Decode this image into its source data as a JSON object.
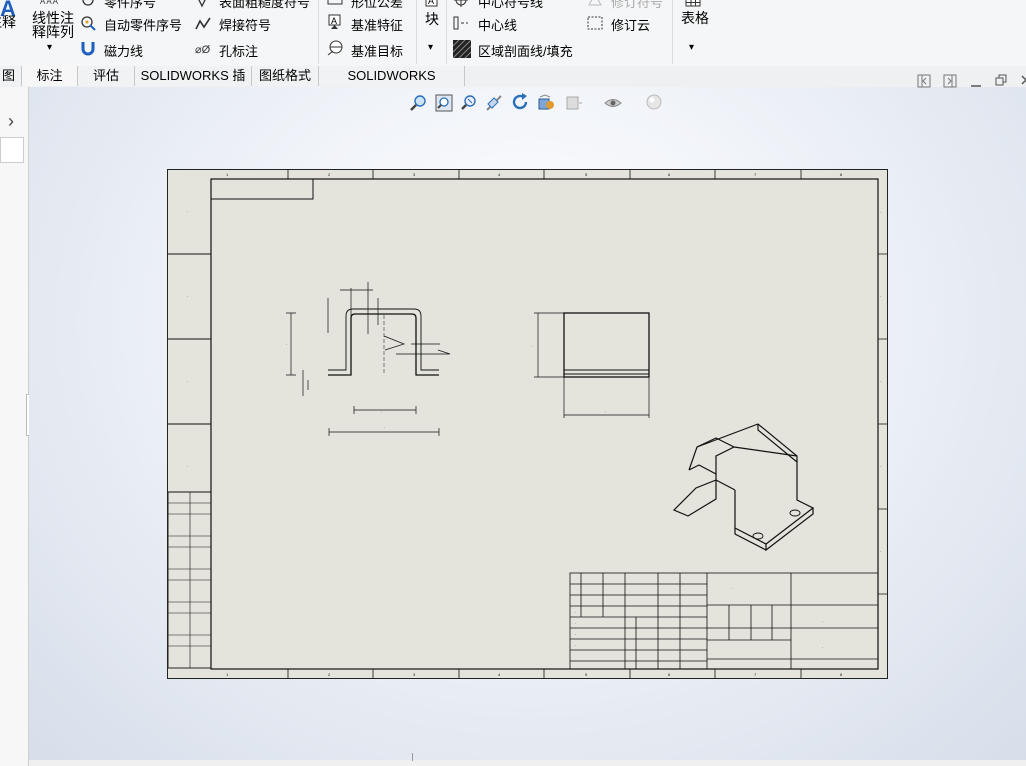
{
  "ribbon": {
    "annotation_big": "注释",
    "linear_pattern": [
      "线性注",
      "释阵列"
    ],
    "part_number": "零件序号",
    "auto_part_number": "自动零件序号",
    "magnetic_line": "磁力线",
    "surface_finish": "表面粗糙度符号",
    "weld_symbol": "焊接符号",
    "hole_callout": "孔标注",
    "geometric_tolerance": "形位公差",
    "datum_feature": "基准特征",
    "datum_target": "基准目标",
    "block": "块",
    "center_mark": "中心符号线",
    "centerline": "中心线",
    "area_hatch": "区域剖面线/填充",
    "revision_symbol": "修订符号",
    "revision_cloud": "修订云",
    "tables": "表格",
    "dropdown_arrow": "▾"
  },
  "tabs": [
    "图",
    "标注",
    "评估",
    "SOLIDWORKS 插件",
    "图纸格式",
    "SOLIDWORKS Inspection"
  ],
  "left_panel": {
    "expand_arrow": "›"
  },
  "heads_up_view": [
    "zoom-to-fit-icon",
    "zoom-to-area-icon",
    "previous-view-icon",
    "section-view-icon",
    "rotate-view-icon",
    "display-style-icon",
    "hide-show-icon",
    "edit-appearance-icon",
    "apply-scene-icon"
  ],
  "window_controls": [
    "tile-left-icon",
    "tile-right-icon",
    "minimize-icon",
    "restore-icon",
    "close-icon"
  ],
  "colors": {
    "sheet": "#e4e4dc",
    "ribbon": "#f5f6f7",
    "accent_blue": "#1f5fbf"
  }
}
